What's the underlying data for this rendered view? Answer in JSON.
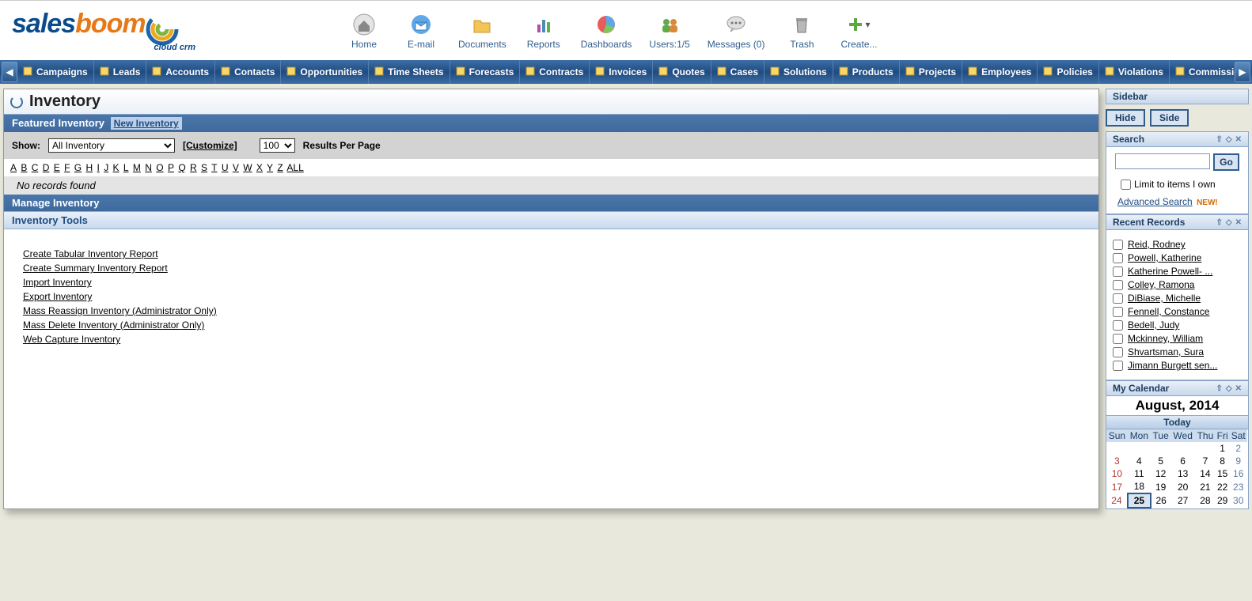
{
  "logo": {
    "part1": "sales",
    "part2": "boom",
    "sub": "cloud crm"
  },
  "topnav": [
    {
      "label": "Home",
      "icon": "home"
    },
    {
      "label": "E-mail",
      "icon": "mail"
    },
    {
      "label": "Documents",
      "icon": "folder"
    },
    {
      "label": "Reports",
      "icon": "bar"
    },
    {
      "label": "Dashboards",
      "icon": "pie"
    },
    {
      "label": "Users:1/5",
      "icon": "users"
    },
    {
      "label": "Messages (0)",
      "icon": "msg"
    },
    {
      "label": "Trash",
      "icon": "trash"
    },
    {
      "label": "Create...",
      "icon": "plus"
    }
  ],
  "navbar": [
    "Campaigns",
    "Leads",
    "Accounts",
    "Contacts",
    "Opportunities",
    "Time Sheets",
    "Forecasts",
    "Contracts",
    "Invoices",
    "Quotes",
    "Cases",
    "Solutions",
    "Products",
    "Projects",
    "Employees",
    "Policies",
    "Violations",
    "Commission Programs"
  ],
  "page": {
    "title": "Inventory",
    "featured_label": "Featured Inventory",
    "new_inventory": "New Inventory",
    "show_label": "Show:",
    "show_value": "All Inventory",
    "customize": "[Customize]",
    "perpage_value": "100",
    "rpp": "Results Per Page",
    "alpha": [
      "A",
      "B",
      "C",
      "D",
      "E",
      "F",
      "G",
      "H",
      "I",
      "J",
      "K",
      "L",
      "M",
      "N",
      "O",
      "P",
      "Q",
      "R",
      "S",
      "T",
      "U",
      "V",
      "W",
      "X",
      "Y",
      "Z",
      "ALL"
    ],
    "norecords": "No records found",
    "manage_label": "Manage Inventory",
    "tools_label": "Inventory Tools",
    "tools": [
      "Create Tabular Inventory Report",
      "Create Summary Inventory Report",
      "Import Inventory",
      "Export Inventory",
      "Mass Reassign Inventory (Administrator Only)",
      "Mass Delete Inventory (Administrator Only)",
      "Web Capture Inventory"
    ]
  },
  "sidebar": {
    "title": "Sidebar",
    "hide": "Hide",
    "side": "Side",
    "search": {
      "title": "Search",
      "go": "Go",
      "own": "Limit to items I own",
      "adv": "Advanced Search",
      "new": "NEW!"
    },
    "recent": {
      "title": "Recent Records",
      "items": [
        "Reid, Rodney",
        "Powell, Katherine",
        "Katherine Powell- ...",
        "Colley, Ramona",
        "DiBiase, Michelle",
        "Fennell, Constance",
        "Bedell, Judy",
        "Mckinney, William",
        "Shvartsman, Sura",
        "Jimann Burgett sen..."
      ]
    },
    "cal": {
      "title": "My Calendar",
      "month": "August, 2014",
      "today": "Today",
      "dow": [
        "Sun",
        "Mon",
        "Tue",
        "Wed",
        "Thu",
        "Fri",
        "Sat"
      ],
      "weeks": [
        [
          "",
          "",
          "",
          "",
          "",
          "1",
          "2"
        ],
        [
          "3",
          "4",
          "5",
          "6",
          "7",
          "8",
          "9"
        ],
        [
          "10",
          "11",
          "12",
          "13",
          "14",
          "15",
          "16"
        ],
        [
          "17",
          "18",
          "19",
          "20",
          "21",
          "22",
          "23"
        ],
        [
          "24",
          "25",
          "26",
          "27",
          "28",
          "29",
          "30"
        ]
      ],
      "today_cell": "25"
    }
  }
}
